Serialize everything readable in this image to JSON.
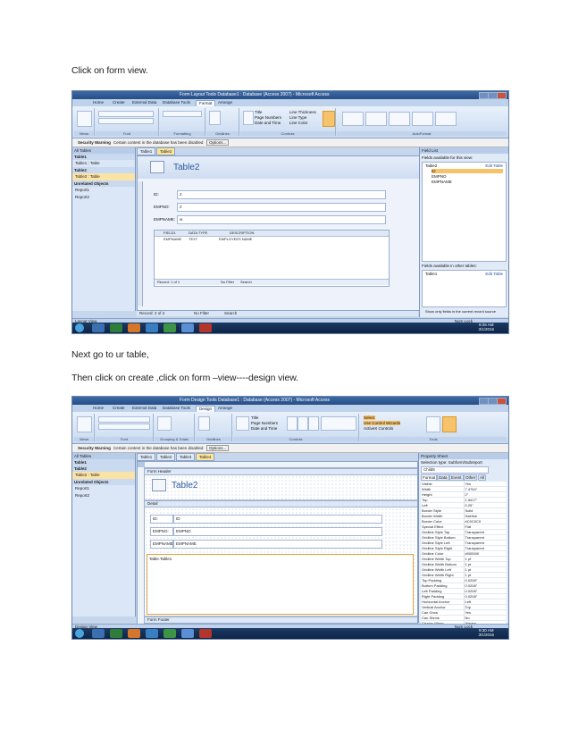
{
  "text": {
    "p1": "Click on form view.",
    "p2": "Next go to ur table,",
    "p3": "Then click on create ,click on form –view----design view."
  },
  "shot1": {
    "window_title": "Form Layout Tools    Database1 : Database (Access 2007) - Microsoft Access",
    "context_tab": "Form Layout Tools",
    "tabs": [
      "Home",
      "Create",
      "External Data",
      "Database Tools",
      "Format",
      "Arrange"
    ],
    "active_tab": "Format",
    "groups": [
      "Views",
      "Font",
      "Formatting",
      "Gridlines",
      "Controls",
      "AutoFormat"
    ],
    "view_label": "View",
    "controls_buttons": [
      "Title",
      "Page Numbers",
      "Date and Time",
      "Line Thickness",
      "Line Type",
      "Line Color"
    ],
    "add_fields": "Add Existing Fields",
    "security_label": "Security Warning",
    "security_text": "Certain content in the database has been disabled",
    "options": "Options...",
    "nav_title": "All Tables",
    "nav": [
      "Table1",
      "Table1 : Table",
      "Table2",
      "Table2 : Table",
      "Unrelated Objects",
      "Report1",
      "Report2"
    ],
    "doc_tabs": [
      "Table1",
      "Table2"
    ],
    "form_name": "Table2",
    "fields": [
      {
        "label": "ID:",
        "value": "2"
      },
      {
        "label": "EMPNO:",
        "value": "2"
      },
      {
        "label": "EMPNAME:",
        "value": "w"
      }
    ],
    "sub_headers": [
      "FIELD1",
      "DATA TYPE",
      "DESCRIPTION"
    ],
    "sub_row": [
      "EMPNAME",
      "TEXT",
      "EMPLOYEES NAME"
    ],
    "sub_record": "Record: 1 of 1",
    "sub_search": "Search",
    "record": "Record: 2 of 2",
    "no_filter": "No Filter",
    "search": "Search",
    "fieldlist_title": "Field List",
    "fieldlist_avail": "Fields available for this view:",
    "fieldlist_table": "Table2",
    "fieldlist_edit": "Edit Table",
    "fieldlist_fields": [
      "ID",
      "EMPNO",
      "EMPNAME"
    ],
    "fieldlist_other": "Fields available in other tables:",
    "fieldlist_other_table": "Table1",
    "fieldlist_show": "Show only fields in the current record source",
    "status_left": "Layout View",
    "status_right": "Num Lock",
    "clock_time": "9:26 AM",
    "clock_date": "3/1/2016"
  },
  "shot2": {
    "window_title": "Form Design Tools    Database1 : Database (Access 2007) - Microsoft Access",
    "context_tab": "Form Design Tools",
    "tabs": [
      "Home",
      "Create",
      "External Data",
      "Database Tools",
      "Design",
      "Arrange"
    ],
    "active_tab": "Design",
    "groups": [
      "Views",
      "Font",
      "Grouping & Totals",
      "Gridlines",
      "Controls",
      "Tools"
    ],
    "controls_buttons": [
      "Title",
      "Page Numbers",
      "Date and Time",
      "Logo",
      "Text Box",
      "Label",
      "Button"
    ],
    "tools_buttons": [
      "Select",
      "Use Control Wizards",
      "ActiveX Controls",
      "Add Existing Fields",
      "Property Sheet"
    ],
    "security_label": "Security Warning",
    "security_text": "Certain content in the database has been disabled",
    "options": "Options...",
    "nav_title": "All Tables",
    "nav": [
      "Table1",
      "Table2",
      "Table2 : Table",
      "Unrelated Objects",
      "Report1",
      "Report2"
    ],
    "doc_tabs": [
      "Table1",
      "Table2",
      "Table3",
      "Table4"
    ],
    "form_header": "Form Header",
    "form_name": "Table2",
    "detail": "Detail",
    "form_footer": "Form Footer",
    "fields": [
      {
        "label": "ID:",
        "value": "ID"
      },
      {
        "label": "EMPNO:",
        "value": "EMPNO"
      },
      {
        "label": "EMPNAME:",
        "value": "EMPNAME"
      }
    ],
    "sub_label": "Table.Table1",
    "property_title": "Property Sheet",
    "selection_type": "Selection type:  Subform/Subreport",
    "selected": "Child6",
    "prop_tabs": [
      "Format",
      "Data",
      "Event",
      "Other",
      "All"
    ],
    "props": [
      [
        "Visible",
        "Yes"
      ],
      [
        "Width",
        "7.4764\""
      ],
      [
        "Height",
        "2\""
      ],
      [
        "Top",
        "1.5417\""
      ],
      [
        "Left",
        "0.25\""
      ],
      [
        "Border Style",
        "Solid"
      ],
      [
        "Border Width",
        "Hairline"
      ],
      [
        "Border Color",
        "#C0C0C0"
      ],
      [
        "Special Effect",
        "Flat"
      ],
      [
        "Gridline Style Top",
        "Transparent"
      ],
      [
        "Gridline Style Bottom",
        "Transparent"
      ],
      [
        "Gridline Style Left",
        "Transparent"
      ],
      [
        "Gridline Style Right",
        "Transparent"
      ],
      [
        "Gridline Color",
        "#000000"
      ],
      [
        "Gridline Width Top",
        "1 pt"
      ],
      [
        "Gridline Width Bottom",
        "1 pt"
      ],
      [
        "Gridline Width Left",
        "1 pt"
      ],
      [
        "Gridline Width Right",
        "1 pt"
      ],
      [
        "Top Padding",
        "0.0208\""
      ],
      [
        "Bottom Padding",
        "0.0208\""
      ],
      [
        "Left Padding",
        "0.0208\""
      ],
      [
        "Right Padding",
        "0.0208\""
      ],
      [
        "Horizontal Anchor",
        "Left"
      ],
      [
        "Vertical Anchor",
        "Top"
      ],
      [
        "Can Grow",
        "Yes"
      ],
      [
        "Can Shrink",
        "No"
      ],
      [
        "Display When",
        "Always"
      ]
    ],
    "status_left": "Design View",
    "status_right": "Num Lock",
    "clock_time": "9:30 AM",
    "clock_date": "3/1/2016"
  }
}
